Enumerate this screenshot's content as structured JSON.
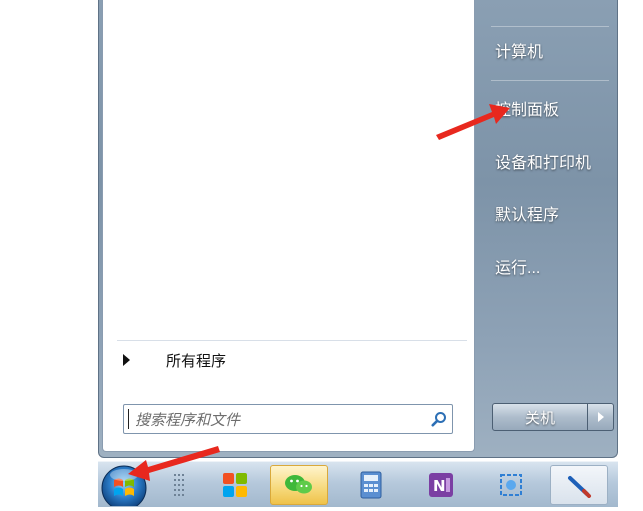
{
  "start_menu": {
    "all_programs_label": "所有程序",
    "search_placeholder": "搜索程序和文件",
    "right_items": [
      {
        "label": "计算机"
      },
      {
        "label": "控制面板"
      },
      {
        "label": "设备和打印机"
      },
      {
        "label": "默认程序"
      },
      {
        "label": "运行..."
      }
    ],
    "shutdown_label": "关机"
  },
  "taskbar": {
    "items": [
      {
        "icon": "start-orb-icon"
      },
      {
        "icon": "grid-handle-icon"
      },
      {
        "icon": "colorful-tiles-app-icon"
      },
      {
        "icon": "wechat-icon"
      },
      {
        "icon": "calculator-icon"
      },
      {
        "icon": "onenote-icon"
      },
      {
        "icon": "screenshot-tool-icon"
      },
      {
        "icon": "pen-tool-icon"
      }
    ]
  },
  "annotations": {
    "arrow_color": "#e8281e"
  },
  "colors": {
    "menu_bg": "#8396aa",
    "taskbar_bg": "#b6c9dc",
    "search_icon": "#2c6fb5"
  }
}
